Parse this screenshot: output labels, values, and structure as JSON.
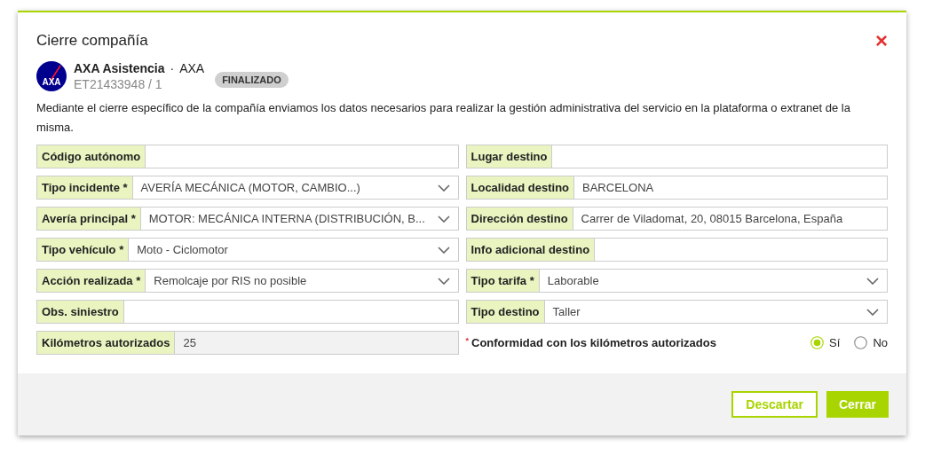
{
  "dialog": {
    "title": "Cierre compañía",
    "close": "×"
  },
  "company": {
    "logo_text": "AXA",
    "name": "AXA Asistencia",
    "separator": "·",
    "code": "AXA",
    "reference": "ET21433948 / 1",
    "status": "FINALIZADO"
  },
  "description": "Mediante el cierre específico de la compañía enviamos los datos necesarios para realizar la gestión administrativa del servicio en la plataforma o extranet de la misma.",
  "left_fields": [
    {
      "kind": "text",
      "label": "Código autónomo"
    },
    {
      "kind": "select",
      "label": "Tipo incidente *",
      "value": "AVERÍA MECÁNICA (MOTOR, CAMBIO...)"
    },
    {
      "kind": "select",
      "label": "Avería principal *",
      "value": "MOTOR: MECÁNICA INTERNA (DISTRIBUCIÓN, B..."
    },
    {
      "kind": "select",
      "label": "Tipo vehículo *",
      "value": "Moto - Ciclomotor"
    },
    {
      "kind": "select",
      "label": "Acción realizada *",
      "value": "Remolcaje por RIS no posible"
    },
    {
      "kind": "text",
      "label": "Obs. siniestro"
    },
    {
      "kind": "readonly",
      "label": "Kilómetros autorizados",
      "value": "25"
    }
  ],
  "right_fields": [
    {
      "kind": "text",
      "label": "Lugar destino"
    },
    {
      "kind": "text",
      "label": "Localidad destino",
      "value": "BARCELONA"
    },
    {
      "kind": "text",
      "label": "Dirección destino",
      "value": "Carrer de Viladomat, 20, 08015 Barcelona, España"
    },
    {
      "kind": "text",
      "label": "Info adicional destino"
    },
    {
      "kind": "select",
      "label": "Tipo tarifa *",
      "value": "Laborable"
    },
    {
      "kind": "select",
      "label": "Tipo destino",
      "value": "Taller"
    }
  ],
  "conformity": {
    "required_mark": "*",
    "label": "Conformidad con los kilómetros autorizados",
    "options": [
      {
        "label": "Sí",
        "selected": true
      },
      {
        "label": "No",
        "selected": false
      }
    ]
  },
  "buttons": [
    {
      "kind": "secondary",
      "label": "Descartar"
    },
    {
      "kind": "primary",
      "label": "Cerrar"
    }
  ]
}
